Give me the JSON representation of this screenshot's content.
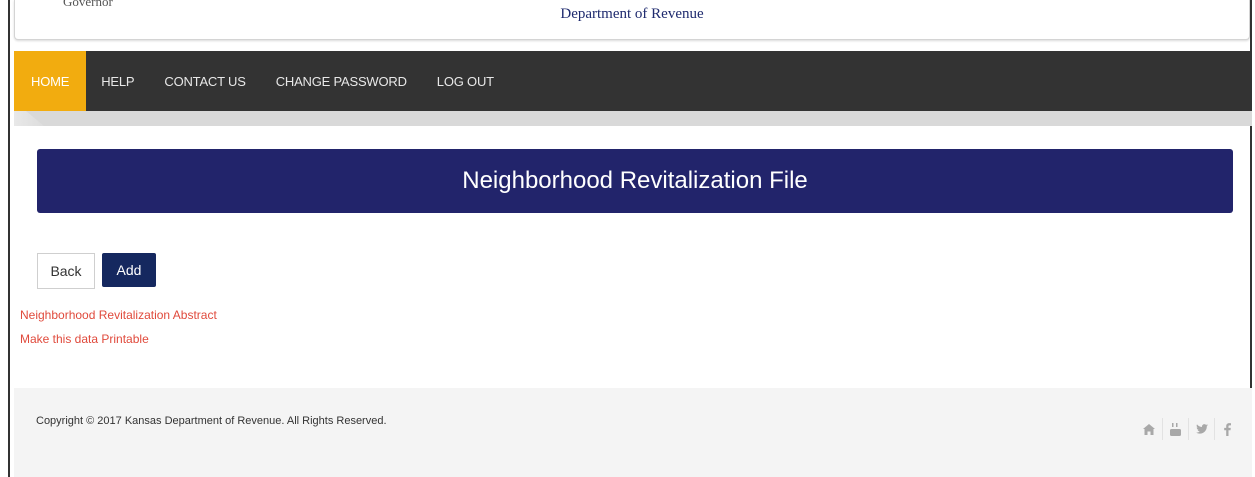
{
  "header": {
    "governor_text": "Governor",
    "department": "Department of Revenue"
  },
  "nav": {
    "items": [
      {
        "label": "HOME",
        "active": true
      },
      {
        "label": "HELP",
        "active": false
      },
      {
        "label": "CONTACT US",
        "active": false
      },
      {
        "label": "CHANGE PASSWORD",
        "active": false
      },
      {
        "label": "LOG OUT",
        "active": false
      }
    ],
    "active_color": "#f2ac0f",
    "bar_color": "#333333"
  },
  "banner": {
    "title": "Neighborhood Revitalization File",
    "color": "#22246b"
  },
  "actions": {
    "back_label": "Back",
    "add_label": "Add"
  },
  "links": {
    "abstract": "Neighborhood Revitalization Abstract",
    "printable": "Make this data Printable"
  },
  "footer": {
    "copyright": "Copyright © 2017 Kansas Department of Revenue. All Rights Reserved.",
    "social_icons": [
      "home-icon",
      "youtube-icon",
      "twitter-icon",
      "facebook-icon"
    ]
  }
}
